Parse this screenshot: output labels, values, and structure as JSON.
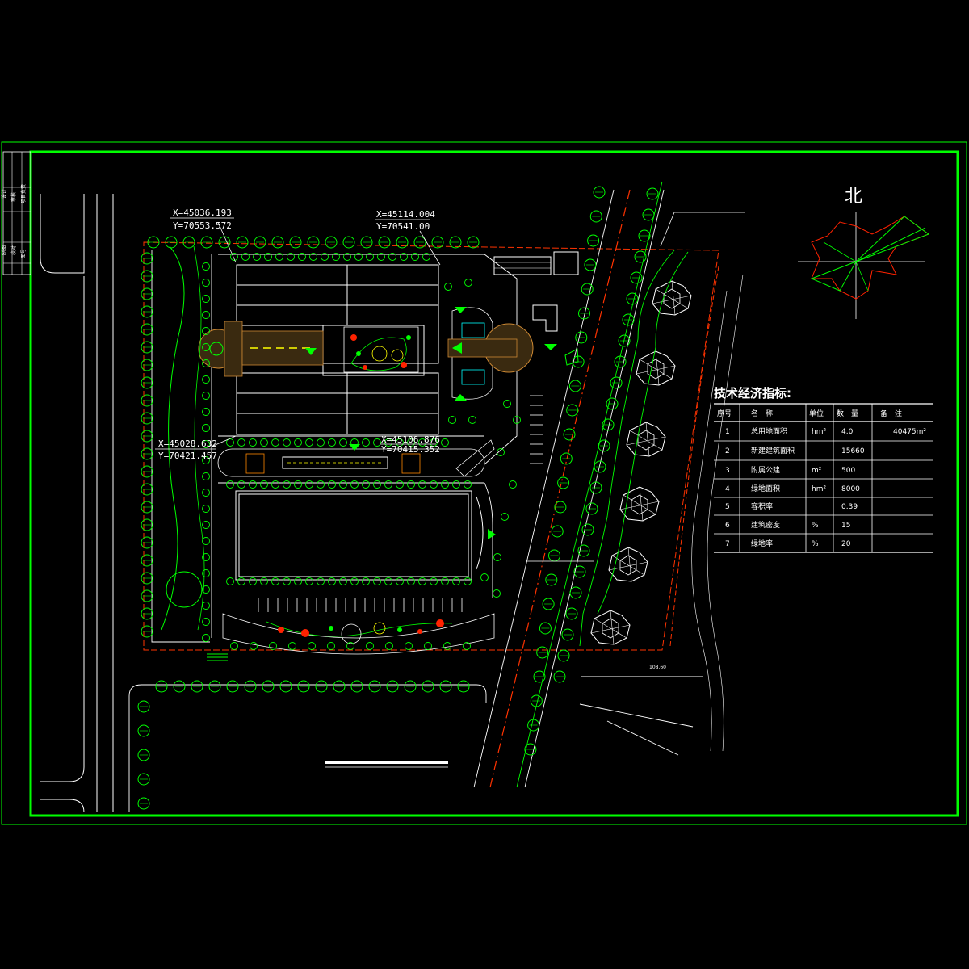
{
  "colors": {
    "background": "#000000",
    "frame": "#00ff00",
    "building_outline": "#ffffff",
    "tree": "#00ff00",
    "property_line": "#ff3300",
    "road_centerline": "#ff3300",
    "text": "#ffffff",
    "highlight_yellow": "#ffff00",
    "accent_cyan": "#00ffff"
  },
  "north_label": "北",
  "coordinates": [
    {
      "x": "X=45036.193",
      "y": "Y=70553.572"
    },
    {
      "x": "X=45114.004",
      "y": "Y=70541.00"
    },
    {
      "x": "X=45028.632",
      "y": "Y=70421.457"
    },
    {
      "x": "X=45106.876",
      "y": "Y=70415.352"
    }
  ],
  "elevation_label": "108.60",
  "title_block": {
    "rows": [
      "设计",
      "审核",
      "项目负责",
      "制图",
      "校对",
      "图号"
    ]
  },
  "table": {
    "title": "技术经济指标:",
    "headers": [
      "序号",
      "名　称",
      "单位",
      "数　量",
      "备　注"
    ],
    "rows": [
      {
        "no": "1",
        "name": "总用地面积",
        "unit": "hm²",
        "qty": "4.0",
        "note": "40475m²"
      },
      {
        "no": "2",
        "name": "新建建筑面积",
        "unit": "",
        "qty": "15660",
        "note": ""
      },
      {
        "no": "3",
        "name": "附属公建",
        "unit": "m²",
        "qty": "500",
        "note": ""
      },
      {
        "no": "4",
        "name": "绿地面积",
        "unit": "hm²",
        "qty": "8000",
        "note": ""
      },
      {
        "no": "5",
        "name": "容积率",
        "unit": "",
        "qty": "0.39",
        "note": ""
      },
      {
        "no": "6",
        "name": "建筑密度",
        "unit": "%",
        "qty": "15",
        "note": ""
      },
      {
        "no": "7",
        "name": "绿地率",
        "unit": "%",
        "qty": "20",
        "note": ""
      }
    ]
  }
}
